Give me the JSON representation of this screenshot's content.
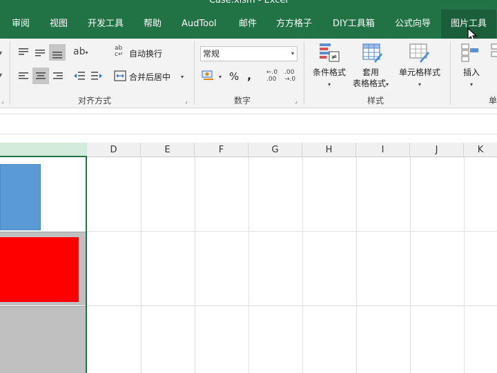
{
  "window": {
    "title": "Case.xlsm  -  Excel"
  },
  "tabs": [
    {
      "label": "审阅",
      "active": false
    },
    {
      "label": "视图",
      "active": false
    },
    {
      "label": "开发工具",
      "active": false
    },
    {
      "label": "帮助",
      "active": false
    },
    {
      "label": "AudTool",
      "active": false
    },
    {
      "label": "邮件",
      "active": false
    },
    {
      "label": "方方格子",
      "active": false
    },
    {
      "label": "DIY工具箱",
      "active": false
    },
    {
      "label": "公式向导",
      "active": false
    },
    {
      "label": "图片工具",
      "active": true
    }
  ],
  "ribbon": {
    "alignment": {
      "label": "对齐方式",
      "wrap_text": "自动换行",
      "merge_center": "合并后居中"
    },
    "number": {
      "label": "数字",
      "format_value": "常规",
      "percent": "%",
      "comma": ","
    },
    "styles": {
      "label": "样式",
      "conditional_format": "条件格式",
      "format_as_table_line1": "套用",
      "format_as_table_line2": "表格格式",
      "cell_styles": "单元格样式"
    },
    "cells": {
      "label": "单",
      "insert": "插入"
    }
  },
  "sheet": {
    "columns": [
      "D",
      "E",
      "F",
      "G",
      "H",
      "I",
      "J",
      "K"
    ]
  },
  "colors": {
    "excel_green": "#217346",
    "shape_blue": "#5b9bd5",
    "shape_red": "#ff0000",
    "band_gray": "#c0c0c0"
  }
}
